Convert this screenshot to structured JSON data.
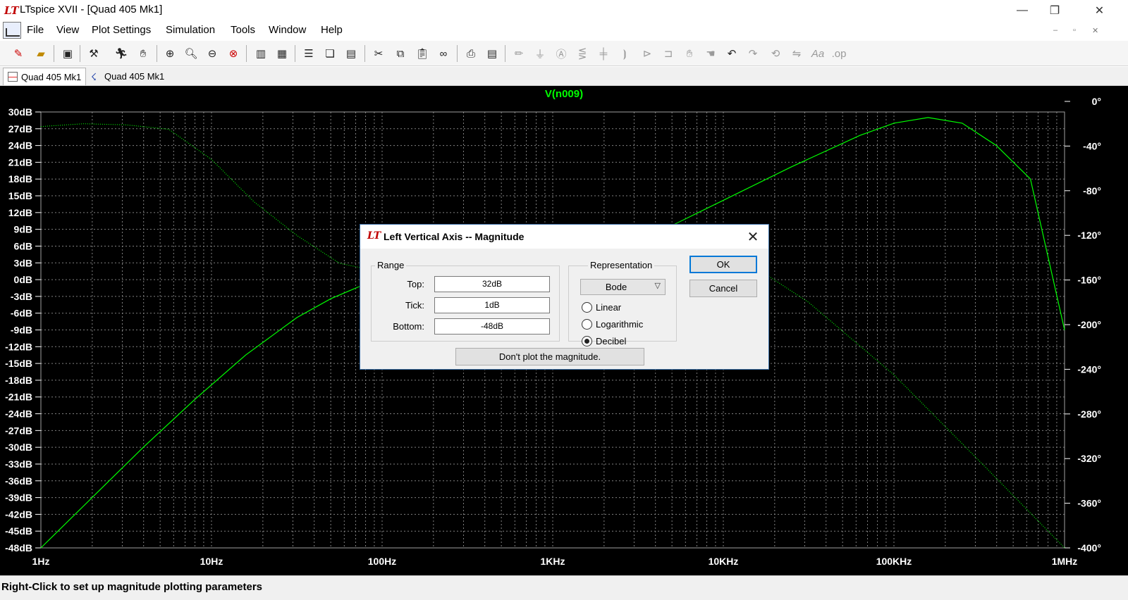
{
  "window": {
    "title": "LTspice XVII - [Quad 405 Mk1]",
    "logo": "LT",
    "minimize": "—",
    "restore": "❐",
    "close": "✕",
    "mdi_minimize": "‒",
    "mdi_restore": "▫",
    "mdi_close": "✕"
  },
  "menu": [
    "File",
    "View",
    "Plot Settings",
    "Simulation",
    "Tools",
    "Window",
    "Help"
  ],
  "toolbar": {
    "icons": [
      "new-schematic-icon",
      "open-icon",
      "save-icon",
      "control-panel-icon",
      "run-icon",
      "pan-hand-icon",
      "zoom-area-icon",
      "zoom-in-icon",
      "zoom-out-icon",
      "zoom-fit-icon",
      "autorange-icon",
      "cursor-icon",
      "tile-horizontal-icon",
      "cascade-icon",
      "tile-vertical-icon",
      "cut-icon",
      "copy-icon",
      "paste-icon",
      "find-icon",
      "print-icon",
      "print-setup-icon",
      "wire-icon",
      "ground-icon",
      "label-net-icon",
      "resistor-icon",
      "capacitor-icon",
      "inductor-icon",
      "diode-icon",
      "component-icon",
      "move-icon",
      "drag-icon",
      "undo-icon",
      "redo-icon",
      "rotate-icon",
      "mirror-icon",
      "text-icon",
      "spice-directive-icon"
    ]
  },
  "tabs": [
    {
      "label": "Quad 405 Mk1",
      "active": true
    },
    {
      "label": "Quad 405 Mk1",
      "active": false
    }
  ],
  "plot": {
    "trace_label": "V(n009)",
    "trace_color": "#00ff00",
    "left_axis": [
      "30dB",
      "27dB",
      "24dB",
      "21dB",
      "18dB",
      "15dB",
      "12dB",
      "9dB",
      "6dB",
      "3dB",
      "0dB",
      "-3dB",
      "-6dB",
      "-9dB",
      "-12dB",
      "-15dB",
      "-18dB",
      "-21dB",
      "-24dB",
      "-27dB",
      "-30dB",
      "-33dB",
      "-36dB",
      "-39dB",
      "-42dB",
      "-45dB",
      "-48dB"
    ],
    "right_axis": [
      "0°",
      "-40°",
      "-80°",
      "-120°",
      "-160°",
      "-200°",
      "-240°",
      "-280°",
      "-320°",
      "-360°",
      "-400°"
    ],
    "x_axis": [
      "1Hz",
      "10Hz",
      "100Hz",
      "1KHz",
      "10KHz",
      "100KHz",
      "1MHz"
    ],
    "magnitude_db": [
      [
        0,
        -48
      ],
      [
        0.3,
        -39
      ],
      [
        0.6,
        -30
      ],
      [
        0.9,
        -21.5
      ],
      [
        1.2,
        -13.5
      ],
      [
        1.5,
        -6.8
      ],
      [
        1.7,
        -3.4
      ],
      [
        1.9,
        -0.8
      ],
      [
        2.1,
        0.5
      ],
      [
        2.3,
        1.2
      ],
      [
        2.5,
        1.4
      ],
      [
        3.0,
        1.7
      ],
      [
        3.3,
        3.5
      ],
      [
        3.6,
        8.2
      ],
      [
        4.0,
        14.2
      ],
      [
        4.4,
        20.2
      ],
      [
        4.8,
        25.8
      ],
      [
        5.0,
        28.0
      ],
      [
        5.2,
        29.0
      ],
      [
        5.4,
        28.0
      ],
      [
        5.6,
        24.0
      ],
      [
        5.8,
        18.0
      ],
      [
        6.0,
        -9.0
      ]
    ],
    "phase_deg": [
      [
        0,
        -22.5
      ],
      [
        0.25,
        -20
      ],
      [
        0.5,
        -21
      ],
      [
        0.75,
        -25
      ],
      [
        1.0,
        -52
      ],
      [
        1.25,
        -90
      ],
      [
        1.5,
        -120
      ],
      [
        1.75,
        -145
      ],
      [
        2.0,
        -153
      ],
      [
        2.5,
        -152
      ],
      [
        3.0,
        -152
      ],
      [
        3.5,
        -140
      ],
      [
        4.0,
        -130
      ],
      [
        4.5,
        -180
      ],
      [
        5.0,
        -245
      ],
      [
        5.5,
        -322
      ],
      [
        6.0,
        -400
      ]
    ],
    "grid": true,
    "grid_color": "#808080",
    "background": "#000000"
  },
  "dialog": {
    "title": "Left Vertical Axis -- Magnitude",
    "range_group": "Range",
    "top_label": "Top:",
    "top_value": "32dB",
    "tick_label": "Tick:",
    "tick_value": "1dB",
    "bottom_label": "Bottom:",
    "bottom_value": "-48dB",
    "representation_group": "Representation",
    "representation_value": "Bode",
    "radio_linear": "Linear",
    "radio_log": "Logarithmic",
    "radio_decibel": "Decibel",
    "selected_radio": "Decibel",
    "ok": "OK",
    "cancel": "Cancel",
    "dont_plot": "Don't plot the magnitude."
  },
  "status": "Right-Click to set up magnitude plotting parameters"
}
